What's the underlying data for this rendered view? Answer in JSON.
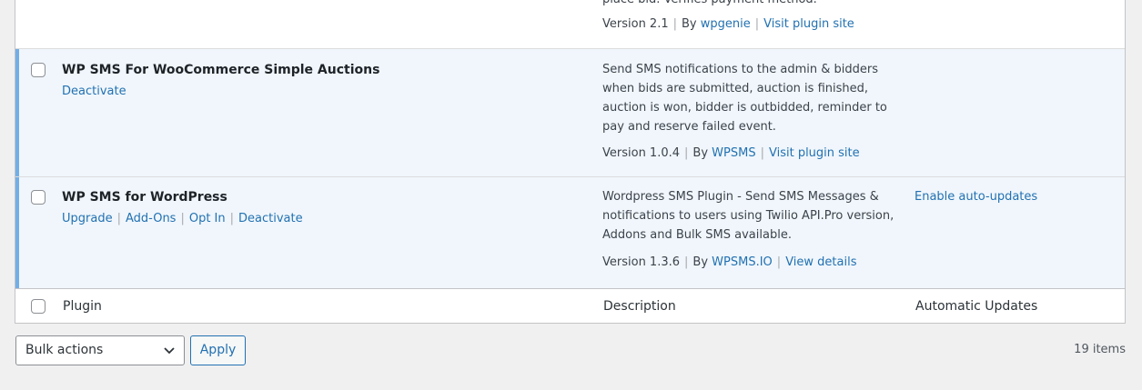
{
  "plugins": [
    {
      "desc_lines": [
        "place bid. Verifies payment method."
      ],
      "version": "Version 2.1",
      "by": "By",
      "author": "wpgenie",
      "site": "Visit plugin site"
    },
    {
      "name": "WP SMS For WooCommerce Simple Auctions",
      "actions": [
        "Deactivate"
      ],
      "desc_lines": [
        "Send SMS notifications to the admin & bidders",
        "when bids are submitted, auction is finished,",
        "auction is won, bidder is outbidded, reminder to",
        "pay and reserve failed event."
      ],
      "version": "Version 1.0.4",
      "by": "By",
      "author": "WPSMS",
      "site": "Visit plugin site"
    },
    {
      "name": "WP SMS for WordPress",
      "actions": [
        "Upgrade",
        "Add-Ons",
        "Opt In",
        "Deactivate"
      ],
      "desc_lines": [
        "Wordpress SMS Plugin - Send SMS Messages &",
        "notifications to users using Twilio API.Pro version,",
        "Addons and Bulk SMS available."
      ],
      "version": "Version 1.3.6",
      "by": "By",
      "author": "WPSMS.IO",
      "site": "View details",
      "auto_update": "Enable auto-updates"
    }
  ],
  "columns": {
    "plugin": "Plugin",
    "description": "Description",
    "auto_updates": "Automatic Updates"
  },
  "bulk_actions": {
    "selected": "Bulk actions",
    "apply": "Apply"
  },
  "item_count": "19 items",
  "colors": {
    "link": "#2271b1",
    "active_row": "#f0f6fc",
    "active_bar": "#72aee6"
  }
}
